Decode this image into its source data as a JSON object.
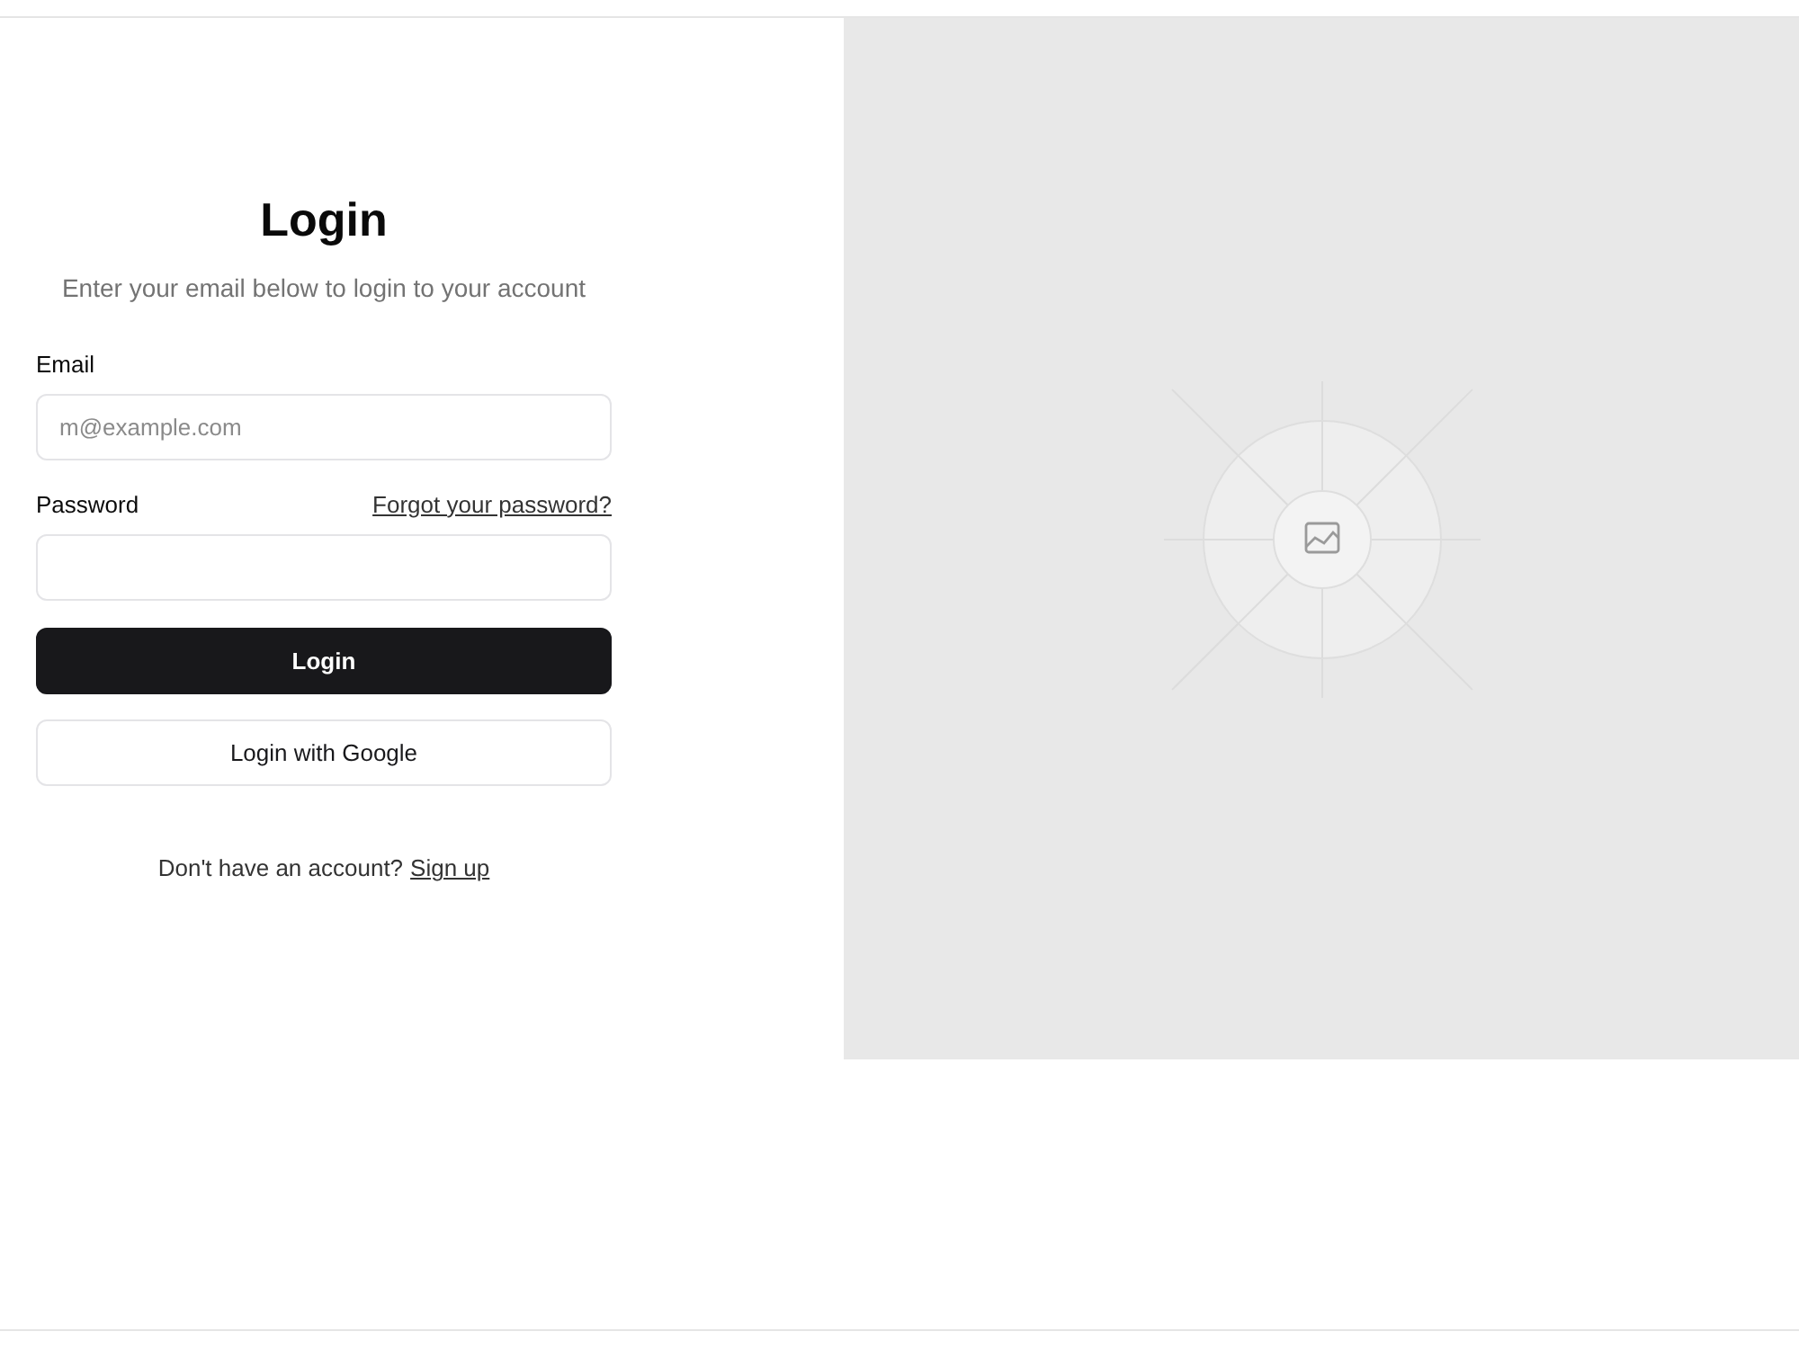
{
  "login_form": {
    "title": "Login",
    "subtitle": "Enter your email below to login to your account",
    "email": {
      "label": "Email",
      "placeholder": "m@example.com"
    },
    "password": {
      "label": "Password",
      "forgot_link": "Forgot your password?"
    },
    "buttons": [
      {
        "kind": "primary",
        "label": "Login"
      },
      {
        "kind": "outline",
        "label": "Login with Google"
      }
    ],
    "signup": {
      "text": "Don't have an account?",
      "link": "Sign up"
    }
  }
}
